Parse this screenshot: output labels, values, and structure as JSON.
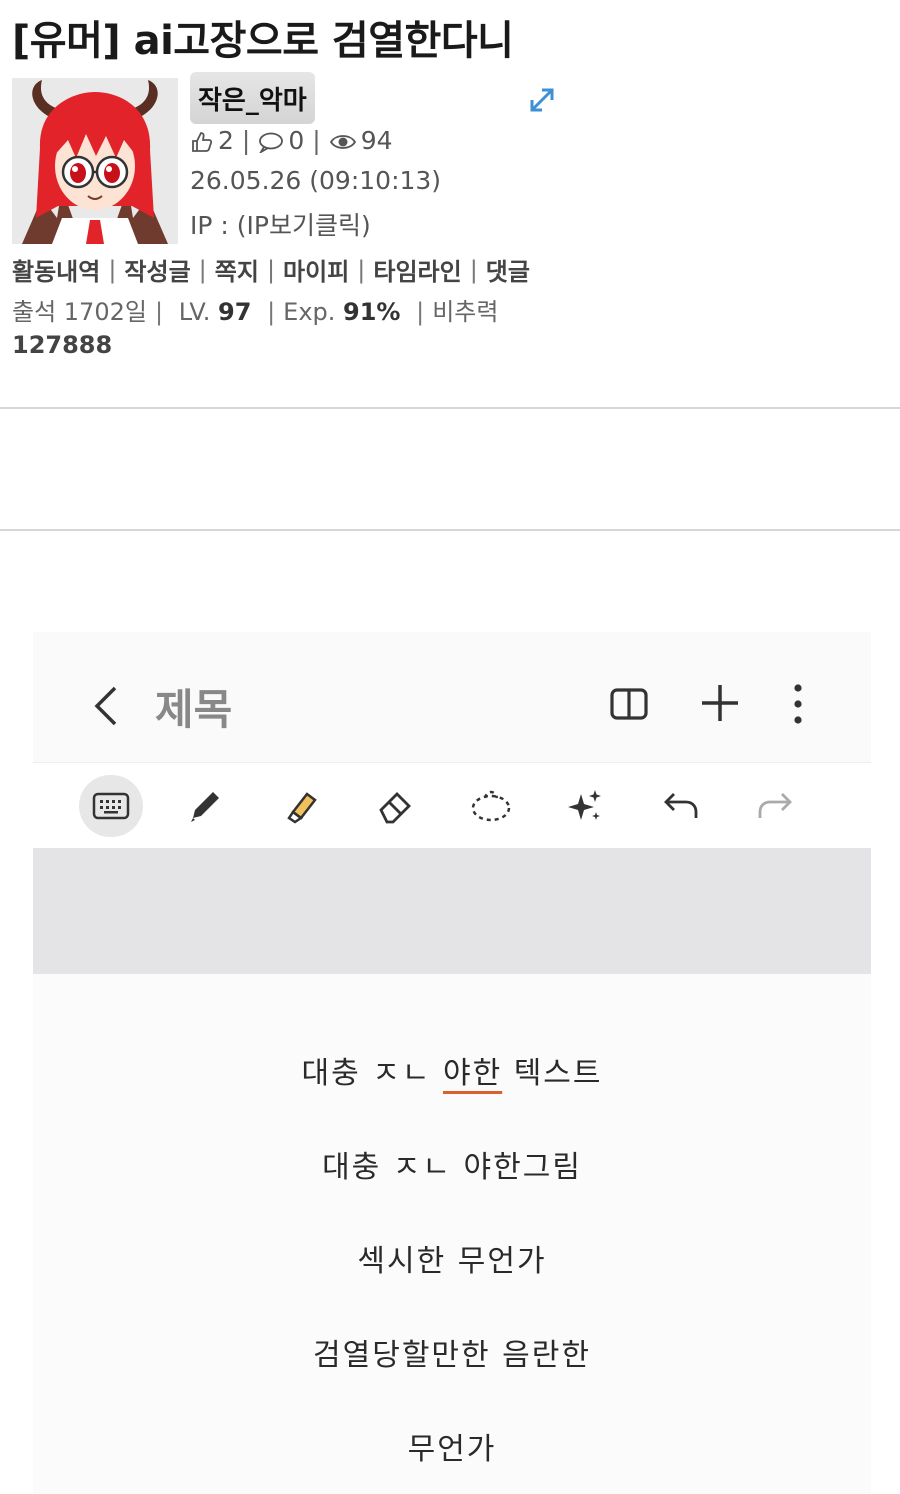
{
  "post": {
    "title": "[유머] ai고장으로 검열한다니"
  },
  "author": {
    "nickname": "작은_악마",
    "avatar_icon": "devil-girl-avatar",
    "likes": "2",
    "comments": "0",
    "views": "94",
    "datetime": "26.05.26 (09:10:13)",
    "ip_label": "IP : ",
    "ip_link": "(IP보기클릭)",
    "links": [
      "활동내역",
      "작성글",
      "쪽지",
      "마이피",
      "타임라인",
      "댓글"
    ],
    "attendance": "출석 1702일",
    "level_label": "LV.",
    "level_value": "97",
    "exp_label": "Exp.",
    "exp_value": "91%",
    "burn_label": "비추력",
    "points": "127888"
  },
  "embedded_app": {
    "doc_title": "제목",
    "toolbar_icons": [
      "keyboard-icon",
      "pen-icon",
      "highlighter-icon",
      "eraser-icon",
      "lasso-icon",
      "ai-sparkle-icon",
      "undo-icon",
      "redo-icon"
    ],
    "handwriting_lines": [
      {
        "before": "대충 ㅈㄴ ",
        "underlined": "야한",
        "after": " 텍스트"
      },
      {
        "before": "대충 ㅈㄴ 야한그림",
        "underlined": "",
        "after": ""
      },
      {
        "before": "섹시한 무언가",
        "underlined": "",
        "after": ""
      },
      {
        "before": "검열당할만한 음란한",
        "underlined": "",
        "after": ""
      },
      {
        "before": "무언가",
        "underlined": "",
        "after": ""
      }
    ]
  },
  "colors": {
    "underline_accent": "#d9622b",
    "expand_icon": "#3d8fd6"
  }
}
